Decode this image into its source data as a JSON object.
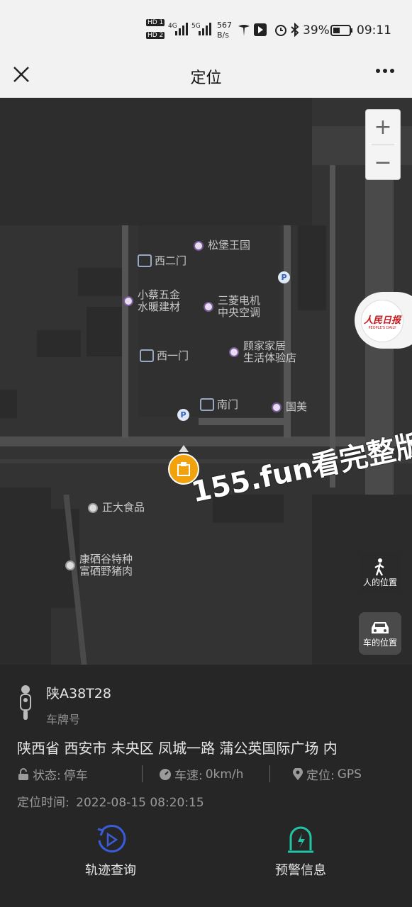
{
  "status": {
    "hd1": "HD 1",
    "hd2": "HD 2",
    "net1": "4G",
    "net2": "5G",
    "speed": "567",
    "speed_unit": "B/s",
    "battery": "39%",
    "time": "09:11"
  },
  "nav": {
    "title": "定位"
  },
  "map": {
    "pois": [
      {
        "name": "松堡王国"
      },
      {
        "name": "西二门"
      },
      {
        "name": "小蔡五金\n水暖建材"
      },
      {
        "name": "三菱电机\n中央空调"
      },
      {
        "name": "西一门"
      },
      {
        "name": "顾家家居\n生活体验店"
      },
      {
        "name": "南门"
      },
      {
        "name": "国美"
      },
      {
        "name": "正大食品"
      },
      {
        "name": "康硒谷特种\n富硒野猪肉"
      }
    ],
    "parking_label": "P",
    "logo_text": "人民日报",
    "logo_sub": "PEOPLE'S DAILY",
    "watermark": "155.fun看完整版",
    "person_position": "人的位置",
    "car_position": "车的位置",
    "zoom_in": "+",
    "zoom_out": "−"
  },
  "vehicle": {
    "plate": "陕A38T28",
    "plate_label": "车牌号",
    "address": "陕西省 西安市 未央区 凤城一路 蒲公英国际广场 内",
    "status_label": "状态:",
    "status_value": "停车",
    "speed_label": "车速:",
    "speed_value": "0km/h",
    "locate_label": "定位:",
    "locate_value": "GPS",
    "time_label": "定位时间:",
    "time_value": "2022-08-15 08:20:15"
  },
  "actions": {
    "track": "轨迹查询",
    "alert": "预警信息"
  },
  "colors": {
    "accent_blue": "#3b5bd9",
    "accent_teal": "#22c4a4",
    "marker_orange": "#f2a20c"
  }
}
